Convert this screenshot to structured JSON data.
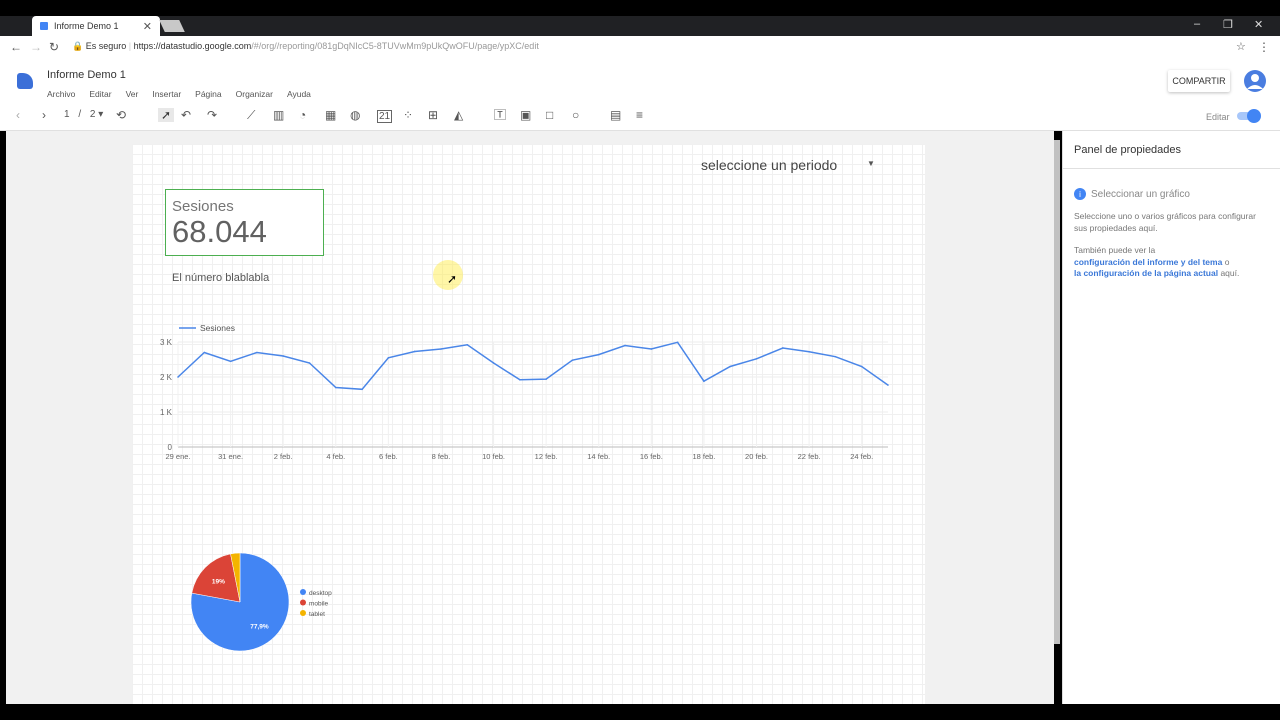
{
  "browser": {
    "tab_title": "Informe Demo 1",
    "secure_label": "Es seguro",
    "url_host": "https://datastudio.google.com",
    "url_path": "/#/org//reporting/081gDqNIcC5-8TUVwMm9pUkQwOFU/page/ypXC/edit"
  },
  "app": {
    "report_title": "Informe Demo 1",
    "menus": [
      "Archivo",
      "Editar",
      "Ver",
      "Insertar",
      "Página",
      "Organizar",
      "Ayuda"
    ],
    "share_label": "COMPARTIR",
    "edit_label": "Editar"
  },
  "toolbar": {
    "page_current": "1",
    "page_sep": "/",
    "page_total": "2"
  },
  "report": {
    "period_selector": "seleccione un periodo",
    "scorecard_label": "Sesiones",
    "scorecard_value": "68.044",
    "description": "El número blablabla"
  },
  "panel": {
    "title": "Panel de propiedades",
    "select_label": "Seleccionar un gráfico",
    "help_text": "Seleccione uno o varios gráficos para configurar sus propiedades aquí.",
    "also_text": "También puede ver la",
    "link1": "configuración del informe y del tema",
    "or_text": "o",
    "link2": "la configuración de la página actual",
    "here_text": "aquí."
  },
  "colors": {
    "accent": "#4285f4",
    "line": "#4a86e8",
    "desktop": "#4285f4",
    "mobile": "#db4437",
    "tablet": "#f4b400"
  },
  "chart_data": [
    {
      "type": "line",
      "series": [
        {
          "name": "Sesiones",
          "values": [
            2000,
            2700,
            2450,
            2700,
            2600,
            2400,
            1700,
            1650,
            2550,
            2730,
            2800,
            2920,
            2400,
            1920,
            1940,
            2480,
            2640,
            2900,
            2800,
            2990,
            1880,
            2300,
            2520,
            2830,
            2720,
            2580,
            2300,
            1770
          ]
        }
      ],
      "x_tick_labels": [
        "29 ene.",
        "31 ene.",
        "2 feb.",
        "4 feb.",
        "6 feb.",
        "8 feb.",
        "10 feb.",
        "12 feb.",
        "14 feb.",
        "16 feb.",
        "18 feb.",
        "20 feb.",
        "22 feb.",
        "24 feb."
      ],
      "y_tick_labels": [
        "0",
        "1 K",
        "2 K",
        "3 K"
      ],
      "ylim": [
        0,
        3000
      ],
      "legend": "top-left"
    },
    {
      "type": "pie",
      "slices": [
        {
          "name": "desktop",
          "value": 77.9,
          "label": "77,9%"
        },
        {
          "name": "mobile",
          "value": 19.0,
          "label": "19%"
        },
        {
          "name": "tablet",
          "value": 3.1,
          "label": ""
        }
      ],
      "legend": "right"
    }
  ]
}
